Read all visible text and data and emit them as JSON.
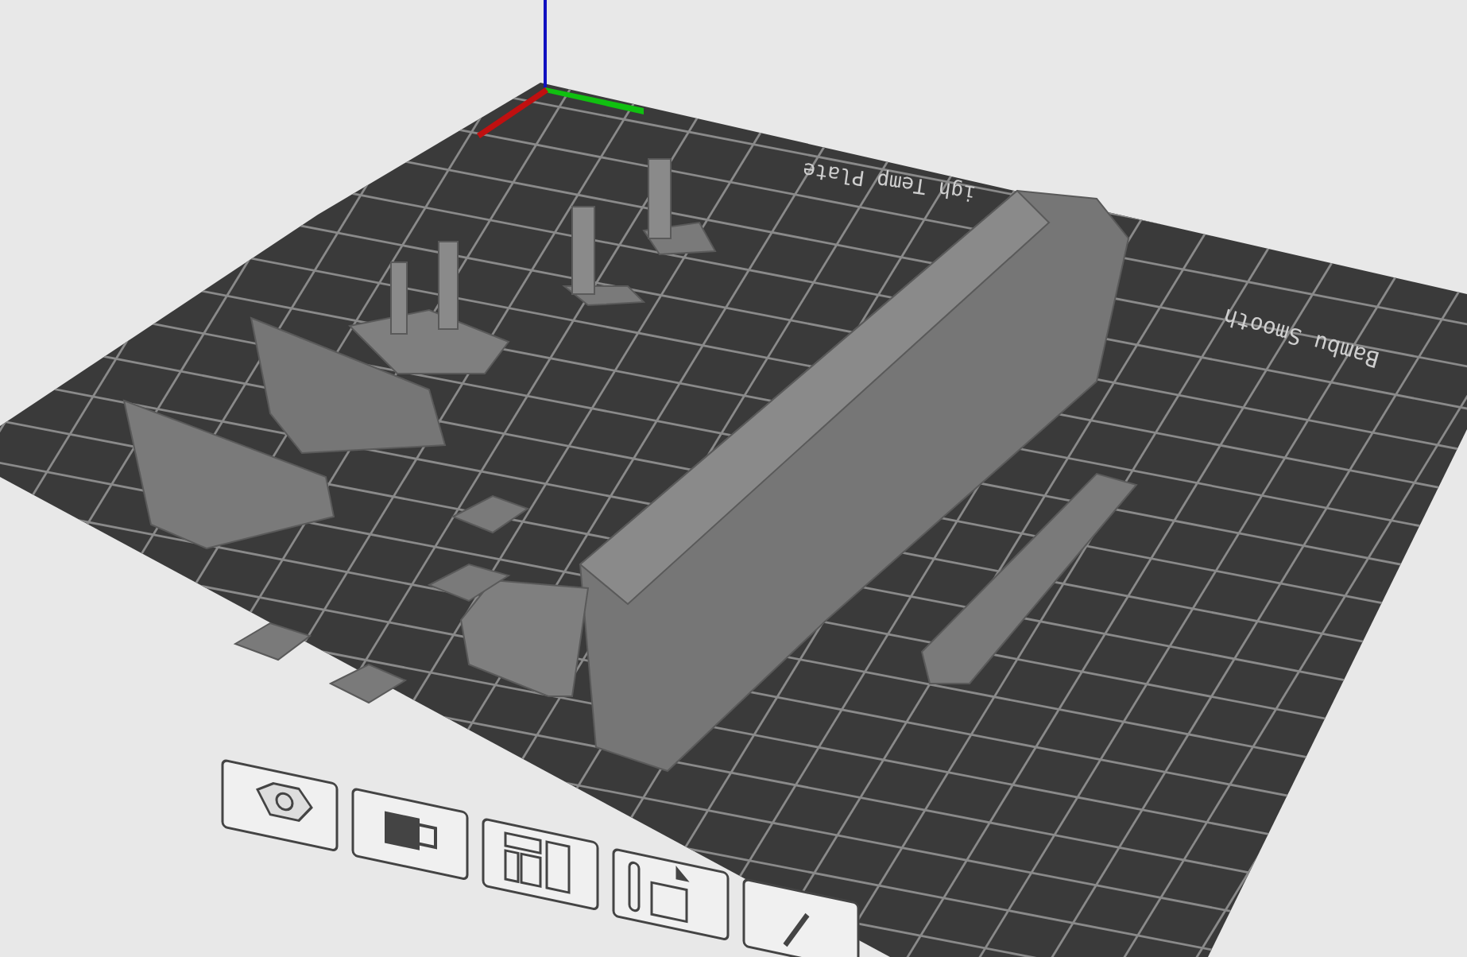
{
  "plate": {
    "labels": [
      {
        "text": "igh Temp Plate"
      },
      {
        "text": "Bambu Smooth"
      }
    ]
  }
}
